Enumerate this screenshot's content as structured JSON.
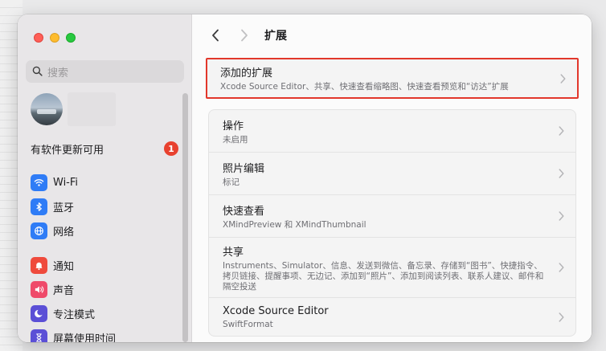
{
  "sidebar": {
    "search_placeholder": "搜索",
    "update_label": "有软件更新可用",
    "update_count": "1",
    "items": [
      {
        "label": "Wi-Fi",
        "icon": "wifi-icon",
        "color": "#2f7cf6"
      },
      {
        "label": "蓝牙",
        "icon": "bluetooth-icon",
        "color": "#2f7cf6"
      },
      {
        "label": "网络",
        "icon": "globe-icon",
        "color": "#2f7cf6"
      },
      {
        "label": "通知",
        "icon": "bell-icon",
        "color": "#ef4a3c"
      },
      {
        "label": "声音",
        "icon": "speaker-icon",
        "color": "#ef4a6a"
      },
      {
        "label": "专注模式",
        "icon": "moon-icon",
        "color": "#5b4fd6"
      },
      {
        "label": "屏幕使用时间",
        "icon": "hourglass-icon",
        "color": "#5b4fd6"
      }
    ]
  },
  "toolbar": {
    "title": "扩展"
  },
  "added": {
    "title": "添加的扩展",
    "subtitle": "Xcode Source Editor、共享、快速查看缩略图、快速查看预览和“访达”扩展"
  },
  "rows": [
    {
      "title": "操作",
      "subtitle": "未启用"
    },
    {
      "title": "照片编辑",
      "subtitle": "标记"
    },
    {
      "title": "快速查看",
      "subtitle": "XMindPreview 和 XMindThumbnail"
    },
    {
      "title": "共享",
      "subtitle": "Instruments、Simulator、信息、发送到微信、备忘录、存储到“图书”、快捷指令、拷贝链接、提醒事项、无边记、添加到“照片”、添加到阅读列表、联系人建议、邮件和隔空投送"
    },
    {
      "title": "Xcode Source Editor",
      "subtitle": "SwiftFormat"
    }
  ],
  "colors": {
    "highlight_border": "#e2372b",
    "badge": "#e8412f"
  }
}
